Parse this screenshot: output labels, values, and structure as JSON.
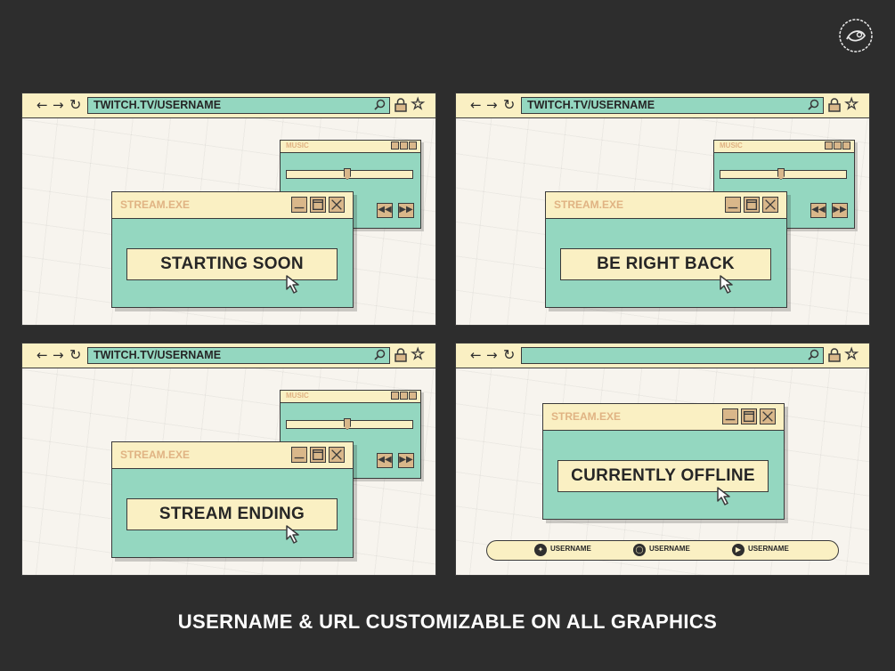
{
  "panels": [
    {
      "url": "TWITCH.TV/USERNAME",
      "music_title": "MUSIC",
      "window_title": "STREAM.EXE",
      "message": "STARTING SOON"
    },
    {
      "url": "TWITCH.TV/USERNAME",
      "music_title": "MUSIC",
      "window_title": "STREAM.EXE",
      "message": "BE RIGHT BACK"
    },
    {
      "url": "TWITCH.TV/USERNAME",
      "music_title": "MUSIC",
      "window_title": "STREAM.EXE",
      "message": "STREAM ENDING"
    },
    {
      "url": "",
      "window_title": "STREAM.EXE",
      "message": "CURRENTLY OFFLINE",
      "socials": [
        {
          "icon": "twitter-icon",
          "name": "USERNAME"
        },
        {
          "icon": "instagram-icon",
          "name": "USERNAME"
        },
        {
          "icon": "youtube-icon",
          "name": "USERNAME"
        }
      ]
    }
  ],
  "caption": "USERNAME & URL CUSTOMIZABLE ON ALL GRAPHICS",
  "colors": {
    "background": "#2d2d2d",
    "cream": "#faf0c3",
    "mint": "#94d7c0",
    "tan": "#d9b78a",
    "title_text": "#e0b383",
    "outline": "#3a3a3a"
  },
  "music_slider_level": 0.48
}
